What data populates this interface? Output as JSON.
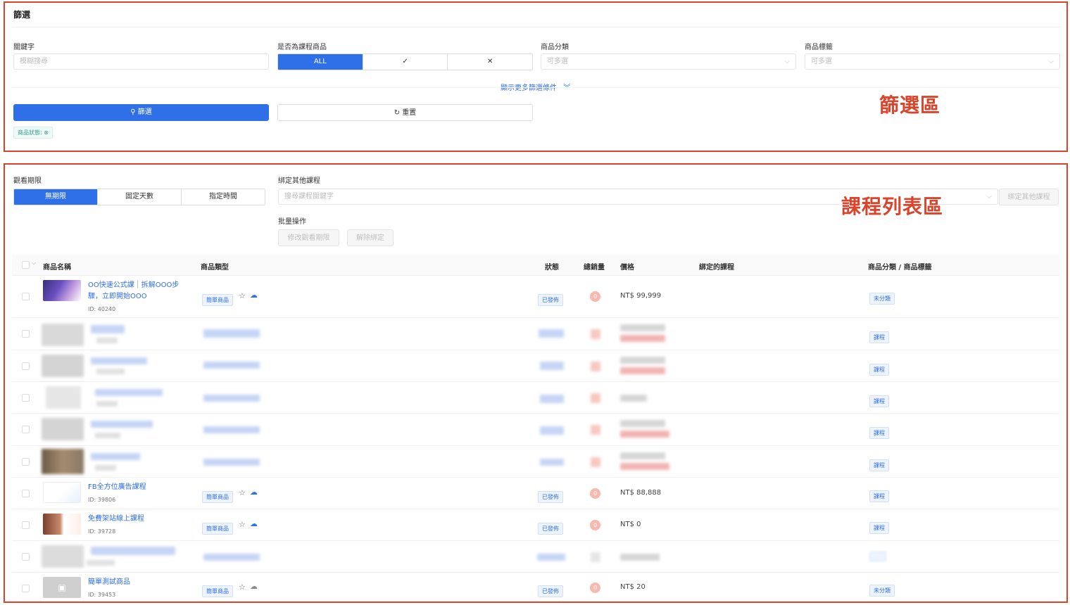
{
  "filter": {
    "title": "篩選",
    "keyword_label": "關鍵字",
    "keyword_placeholder": "模糊搜尋",
    "course_label": "是否為課程商品",
    "course_options": [
      "ALL",
      "✓",
      "✕"
    ],
    "category_label": "商品分類",
    "category_placeholder": "可多選",
    "tag_label": "商品標籤",
    "tag_placeholder": "可多選",
    "more_label": "顯示更多篩選條件",
    "search_button": "篩選",
    "reset_button": "重置",
    "status_chip": "商品狀態:",
    "annotation": "篩選區"
  },
  "list": {
    "annotation": "課程列表區",
    "watch_label": "觀看期限",
    "watch_options": [
      "無期限",
      "固定天數",
      "指定時間"
    ],
    "bind_label": "綁定其他課程",
    "bind_placeholder": "搜尋課程關鍵字",
    "bind_button": "綁定其他課程",
    "batch_label": "批量操作",
    "batch_edit": "修改觀看期限",
    "batch_unbind": "解除綁定",
    "columns": {
      "name": "商品名稱",
      "type": "商品類型",
      "status": "狀態",
      "sales": "總銷量",
      "price": "價格",
      "bound": "綁定的課程",
      "category": "商品分類 / 商品標籤"
    },
    "rows": [
      {
        "name": "OO快速公式課｜拆解OOO步驟，立即開始OOO",
        "id": "ID: 40240",
        "type": "簡單商品",
        "status": "已發佈",
        "sales": "0",
        "price": "NT$  99,999",
        "category": "未分類"
      },
      {
        "category": "課程"
      },
      {
        "category": "課程"
      },
      {
        "category": "課程"
      },
      {
        "category": "課程"
      },
      {
        "category": "課程"
      },
      {
        "name": "FB全方位廣告課程",
        "id": "ID: 39806",
        "type": "簡單商品",
        "status": "已發佈",
        "sales": "0",
        "price": "NT$  88,888",
        "category": "課程"
      },
      {
        "name": "免費架站線上課程",
        "id": "ID: 39728",
        "type": "簡單商品",
        "status": "已發佈",
        "sales": "0",
        "price": "NT$  0",
        "category": "課程"
      },
      {
        "category": ""
      },
      {
        "name": "簡單測試商品",
        "id": "ID: 39453",
        "type": "簡單商品",
        "status": "已發佈",
        "sales": "0",
        "price": "NT$  20",
        "category": "未分類"
      }
    ]
  },
  "colors": {
    "accent": "#2f6fe8",
    "annotation": "#d9442b"
  }
}
